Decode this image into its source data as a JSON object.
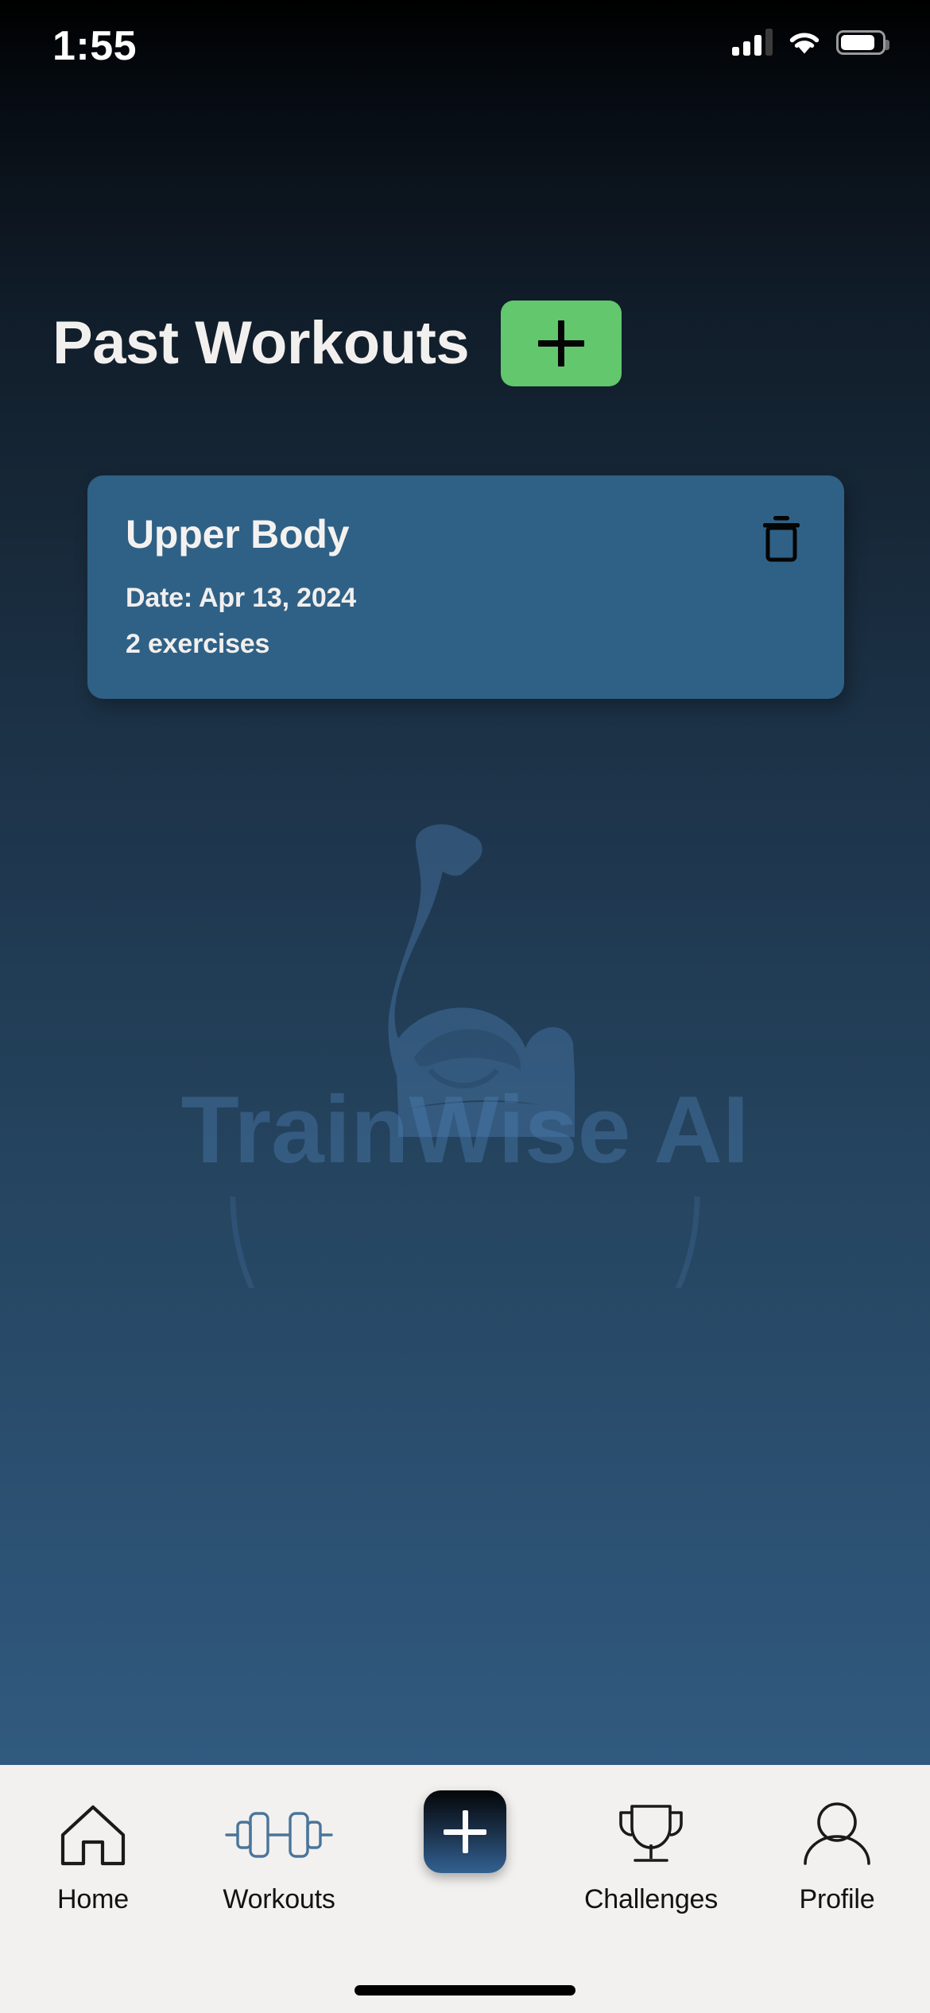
{
  "status_bar": {
    "time": "1:55",
    "cellular_icon": "signal-bars-icon",
    "wifi_icon": "wifi-icon",
    "battery_icon": "battery-icon",
    "battery_level_percent": 84
  },
  "header": {
    "title": "Past Workouts",
    "add_button_icon": "plus-icon",
    "add_button_color": "#62C76D"
  },
  "workouts": [
    {
      "name": "Upper Body",
      "date": "Date: Apr 13, 2024",
      "exercise_count": "2 exercises",
      "delete_icon": "trash-icon",
      "card_color": "#2F6186"
    }
  ],
  "watermark": {
    "brand": "TrainWise AI",
    "logo_icon": "flexed-bicep-icon"
  },
  "tab_bar": {
    "background_color": "#F2F1EF",
    "items": [
      {
        "label": "Home",
        "icon": "home-icon"
      },
      {
        "label": "Workouts",
        "icon": "dumbbell-icon"
      },
      {
        "label": "",
        "icon": "plus-icon"
      },
      {
        "label": "Challenges",
        "icon": "trophy-icon"
      },
      {
        "label": "Profile",
        "icon": "person-icon"
      }
    ]
  },
  "colors": {
    "background_top": "#000000",
    "background_bottom": "#36628C",
    "accent_green": "#62C76D",
    "card_blue": "#2F6186",
    "text_light": "#F2F0EE"
  }
}
